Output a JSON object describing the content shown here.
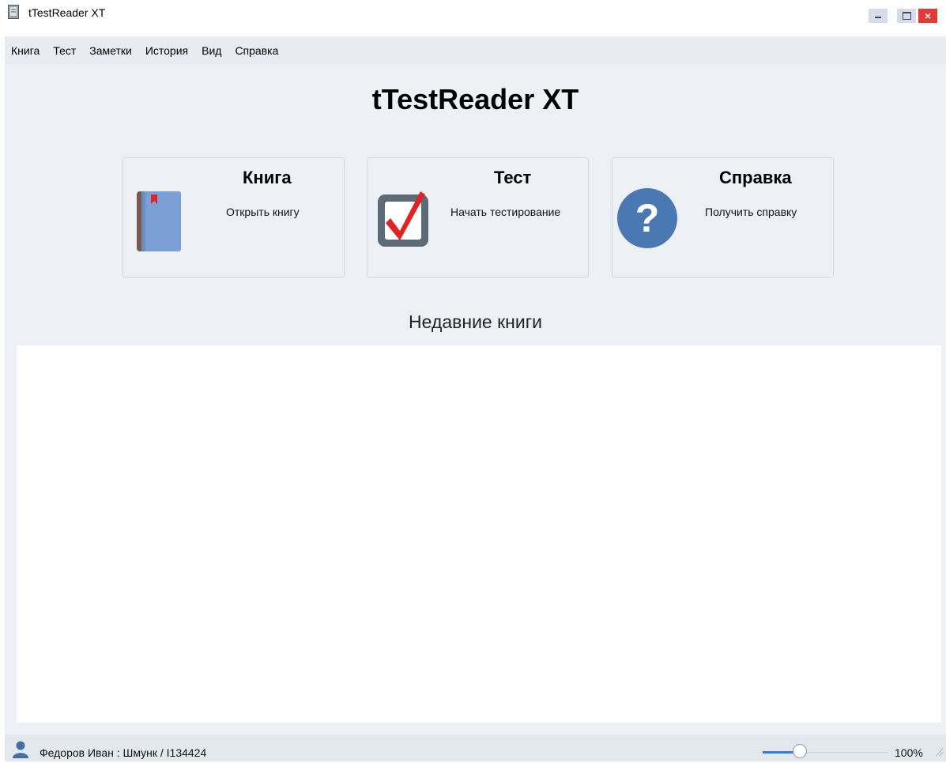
{
  "window": {
    "title": "tTestReader XT",
    "icons": {
      "app": "book-app-icon",
      "minimize": "minimize-icon",
      "maximize": "maximize-icon",
      "close": "close-icon"
    },
    "close_glyph": "×"
  },
  "menu": [
    "Книга",
    "Тест",
    "Заметки",
    "История",
    "Вид",
    "Справка"
  ],
  "main": {
    "heading": "tTestReader XT",
    "cards": [
      {
        "title": "Книга",
        "description": "Открыть книгу",
        "icon": "book-icon"
      },
      {
        "title": "Тест",
        "description": "Начать тестирование",
        "icon": "checkbox-check-icon"
      },
      {
        "title": "Справка",
        "description": "Получить справку",
        "icon": "question-mark-icon"
      }
    ],
    "recent_heading": "Недавние книги",
    "recent_items": []
  },
  "status": {
    "user_text": "Федоров Иван : Шмунк / I134424",
    "user_icon": "user-icon",
    "zoom_label": "100%",
    "zoom_slider_level": 0.3
  },
  "colors": {
    "accent": "#2f7fd6",
    "book": "#7aa0d6",
    "book_spine": "#7a5a4e",
    "checkbox_frame": "#5d6a78",
    "check_mark": "#e02424",
    "help_circle": "#4a78b2",
    "close_button": "#e53935",
    "user_icon": "#3f6fa3"
  }
}
